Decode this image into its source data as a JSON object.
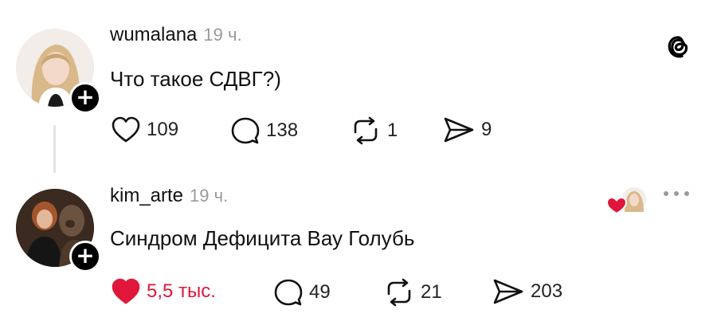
{
  "posts": [
    {
      "username": "wumalana",
      "time": "19 ч.",
      "text": "Что такое СДВГ?)",
      "likes": "109",
      "replies": "138",
      "reposts": "1",
      "shares": "9"
    },
    {
      "username": "kim_arte",
      "time": "19 ч.",
      "text": "Синдром Дефицита Вау Голубь",
      "likes": "5,5 тыс.",
      "replies": "49",
      "reposts": "21",
      "shares": "203"
    }
  ],
  "icons": {
    "app_logo": "threads-logo-icon",
    "like": "heart-icon",
    "reply": "speech-bubble-icon",
    "repost": "repost-arrows-icon",
    "share": "send-icon",
    "follow": "plus-icon",
    "more": "more-dots-icon"
  },
  "colors": {
    "accent_like": "#e0173a",
    "muted_text": "#9a9a9a"
  },
  "follow_symbol": "+"
}
